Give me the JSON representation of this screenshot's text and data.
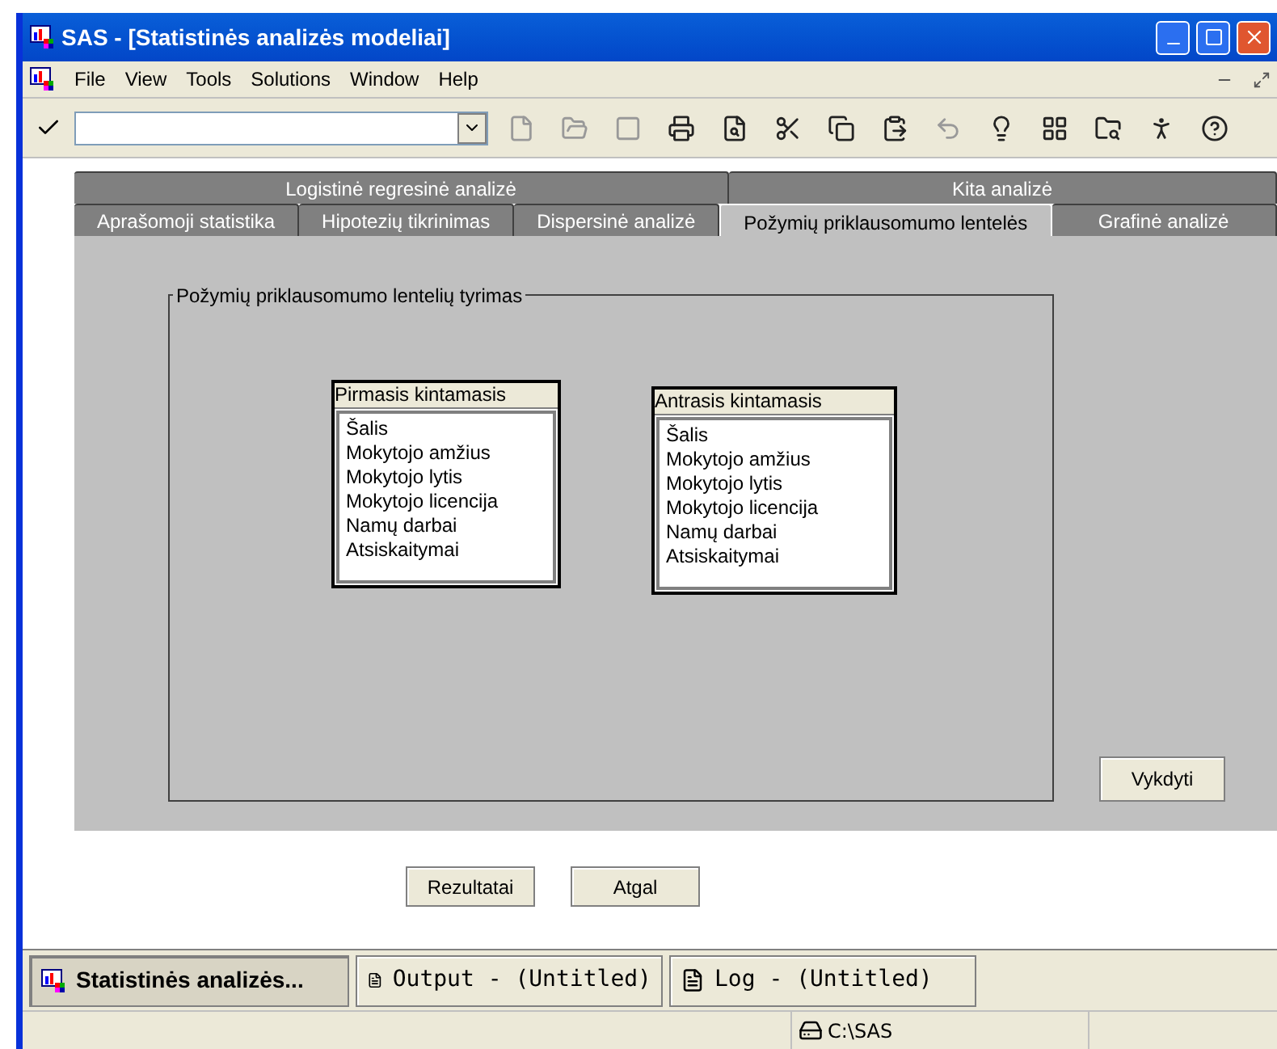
{
  "window": {
    "title": "SAS - [Statistinės analizės modeliai]"
  },
  "menu": [
    "File",
    "View",
    "Tools",
    "Solutions",
    "Window",
    "Help"
  ],
  "tab_rows": [
    [
      {
        "label": "Logistinė regresinė analizė",
        "selected": false
      },
      {
        "label": "Kita analizė",
        "selected": false
      }
    ],
    [
      {
        "label": "Aprašomoji statistika",
        "selected": false
      },
      {
        "label": "Hipotezių tikrinimas",
        "selected": false
      },
      {
        "label": "Dispersinė analizė",
        "selected": false
      },
      {
        "label": "Požymių priklausomumo lentelės",
        "selected": true
      },
      {
        "label": "Grafinė analizė",
        "selected": false
      }
    ]
  ],
  "group": {
    "title": "Požymių priklausomumo lentelių tyrimas",
    "lists": [
      {
        "header": "Pirmasis kintamasis",
        "items": [
          "Šalis",
          "Mokytojo amžius",
          "Mokytojo lytis",
          "Mokytojo licencija",
          "Namų darbai",
          "Atsiskaitymai"
        ]
      },
      {
        "header": "Antrasis kintamasis",
        "items": [
          "Šalis",
          "Mokytojo amžius",
          "Mokytojo lytis",
          "Mokytojo licencija",
          "Namų darbai",
          "Atsiskaitymai"
        ]
      }
    ]
  },
  "run_button": "Vykdyti",
  "bottom_buttons": [
    "Rezultatai",
    "Atgal"
  ],
  "taskbar": [
    {
      "label": "Statistinės analizės...",
      "kind": "app",
      "selected": true
    },
    {
      "label": "Output - (Untitled)",
      "kind": "output",
      "selected": false
    },
    {
      "label": "Log - (Untitled)",
      "kind": "log",
      "selected": false
    }
  ],
  "status_bar": {
    "path": "C:\\SAS"
  }
}
